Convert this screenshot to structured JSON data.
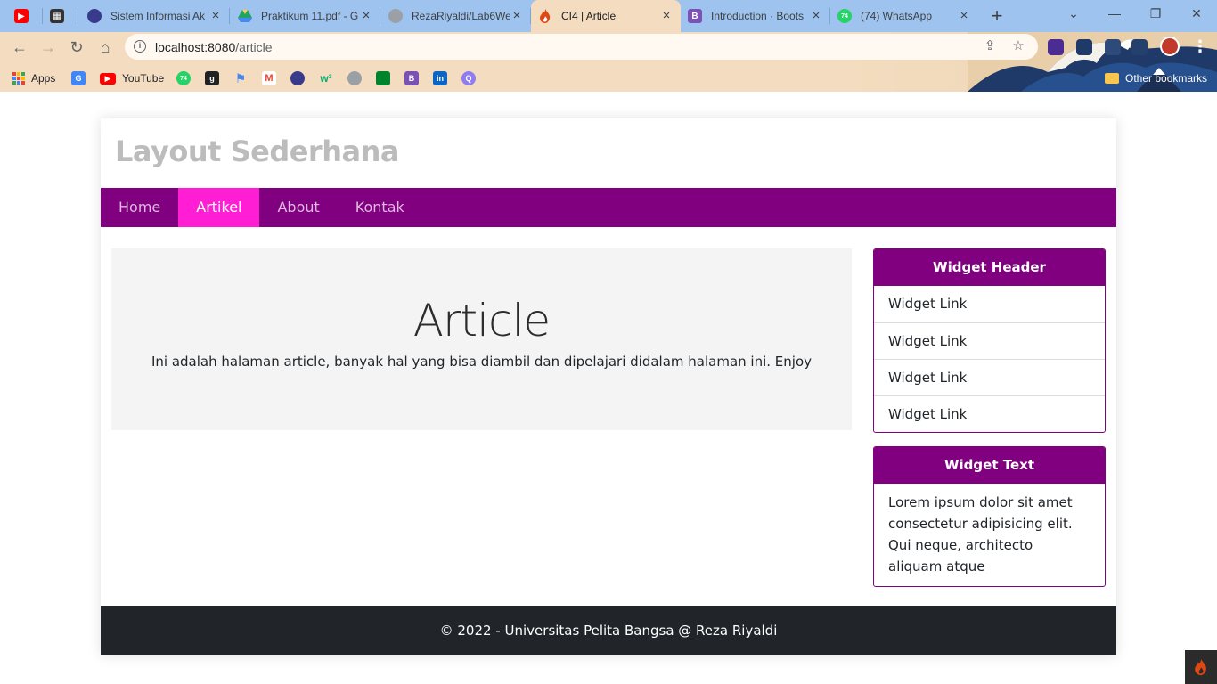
{
  "browser": {
    "tabs": [
      {
        "title": "",
        "favicon": "youtube-icon",
        "color": "#ff0000"
      },
      {
        "title": "",
        "favicon": "qr-icon",
        "color": "#333333"
      },
      {
        "title": "Sistem Informasi Ak",
        "favicon": "university-icon",
        "color": "#3a3a8c"
      },
      {
        "title": "Praktikum 11.pdf - G",
        "favicon": "google-drive-icon",
        "color": "#1fa463"
      },
      {
        "title": "RezaRiyaldi/Lab6We",
        "favicon": "github-icon",
        "color": "#9aa0a6"
      },
      {
        "title": "CI4 | Article",
        "favicon": "codeigniter-icon",
        "color": "#dd4814"
      },
      {
        "title": "Introduction · Boots",
        "favicon": "bootstrap-icon",
        "color": "#7952b3"
      },
      {
        "title": "(74) WhatsApp",
        "favicon": "whatsapp-icon",
        "color": "#25d366"
      }
    ],
    "whatsapp_count": "74",
    "url_host": "localhost:8080",
    "url_path": "/article",
    "bookmarks": {
      "apps_label": "Apps",
      "youtube_label": "YouTube",
      "other_label": "Other bookmarks",
      "wa_badge": "74"
    }
  },
  "site": {
    "title": "Layout Sederhana",
    "nav": [
      "Home",
      "Artikel",
      "About",
      "Kontak"
    ],
    "active_nav": "Artikel",
    "hero": {
      "title": "Article",
      "text": "Ini adalah halaman article, banyak hal yang bisa diambil dan dipelajari didalam halaman ini. Enjoy"
    },
    "widget_links": {
      "header": "Widget Header",
      "links": [
        "Widget Link",
        "Widget Link",
        "Widget Link",
        "Widget Link"
      ]
    },
    "widget_text": {
      "header": "Widget Text",
      "body": "Lorem ipsum dolor sit amet consectetur adipisicing elit. Qui neque, architecto aliquam atque"
    },
    "footer": "© 2022 - Universitas Pelita Bangsa @ Reza Riyaldi"
  },
  "colors": {
    "primary": "#800080",
    "nav_active": "#ff1ed4",
    "footer_bg": "#212529",
    "hero_bg": "#f4f4f4"
  }
}
